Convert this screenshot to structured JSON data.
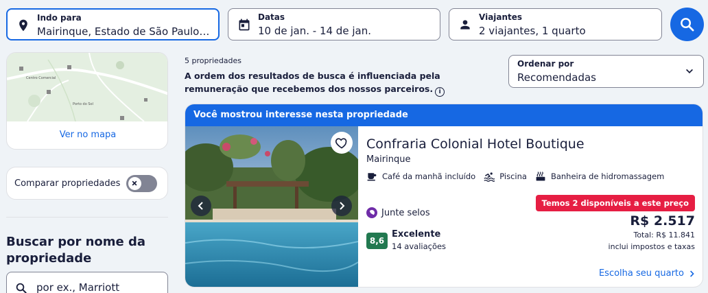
{
  "search": {
    "destination": {
      "label": "Indo para",
      "value": "Mairinque, Estado de São Paulo, B..."
    },
    "dates": {
      "label": "Datas",
      "value": "10 de jan. - 14 de jan."
    },
    "travelers": {
      "label": "Viajantes",
      "value": "2 viajantes, 1 quarto"
    }
  },
  "sidebar": {
    "map_link": "Ver no mapa",
    "map_labels": [
      "Centro Comercial",
      "Porto do Sol"
    ],
    "compare_label": "Comparar propriedades",
    "name_search_title": "Buscar por nome da propriedade",
    "name_search_placeholder": "por ex., Marriott"
  },
  "results": {
    "count": "5 propriedades",
    "disclaimer": "A ordem dos resultados de busca é influenciada pela remuneração que recebemos dos nossos parceiros.",
    "sort_label": "Ordenar por",
    "sort_value": "Recomendadas"
  },
  "listing": {
    "banner": "Você mostrou interesse nesta propriedade",
    "name": "Confraria Colonial Hotel Boutique",
    "city": "Mairinque",
    "amenities": [
      "Café da manhã incluído",
      "Piscina",
      "Banheira de hidromassagem"
    ],
    "loyalty": "Junte selos",
    "score": "8,6",
    "score_word": "Excelente",
    "reviews": "14 avaliações",
    "availability": "Temos 2 disponíveis a este preço",
    "price": "R$ 2.517",
    "total": "Total: R$ 11.841",
    "taxes": "inclui impostos e taxas",
    "cta": "Escolha seu quarto"
  },
  "colors": {
    "primary": "#1668e3",
    "urgent": "#e61e43",
    "rating": "#227950",
    "loyalty": "#6f2da8"
  }
}
